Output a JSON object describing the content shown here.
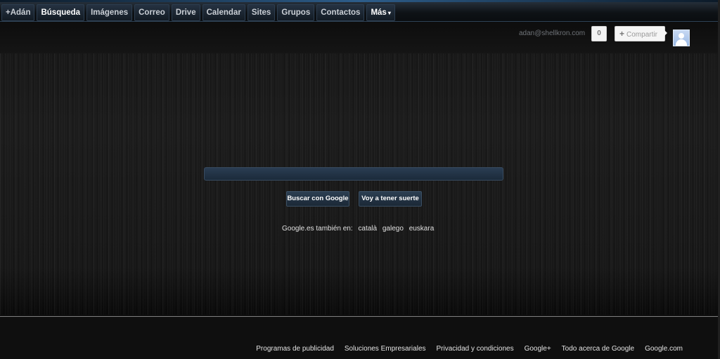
{
  "nav": {
    "items": [
      {
        "label": "+Adán"
      },
      {
        "label": "Búsqueda"
      },
      {
        "label": "Imágenes"
      },
      {
        "label": "Correo"
      },
      {
        "label": "Drive"
      },
      {
        "label": "Calendar"
      },
      {
        "label": "Sites"
      },
      {
        "label": "Grupos"
      },
      {
        "label": "Contactos"
      },
      {
        "label": "Más"
      }
    ],
    "active_index": 1
  },
  "account": {
    "email": "adan@shellkron.com",
    "notification_count": "0",
    "share_label": "Compartir",
    "avatar_icon": "user-avatar-icon"
  },
  "search": {
    "value": "",
    "search_button_label": "Buscar con Google",
    "lucky_button_label": "Voy a tener suerte"
  },
  "languages": {
    "intro": "Google.es también en:",
    "links": [
      "català",
      "galego",
      "euskara"
    ]
  },
  "footer": {
    "links": [
      "Programas de publicidad",
      "Soluciones Empresariales",
      "Privacidad y condiciones",
      "Google+",
      "Todo acerca de Google",
      "Google.com"
    ]
  },
  "colors": {
    "background": "#1a1a1a",
    "accent_blue": "#2d5d8a",
    "text_light": "#e4e4e4"
  }
}
